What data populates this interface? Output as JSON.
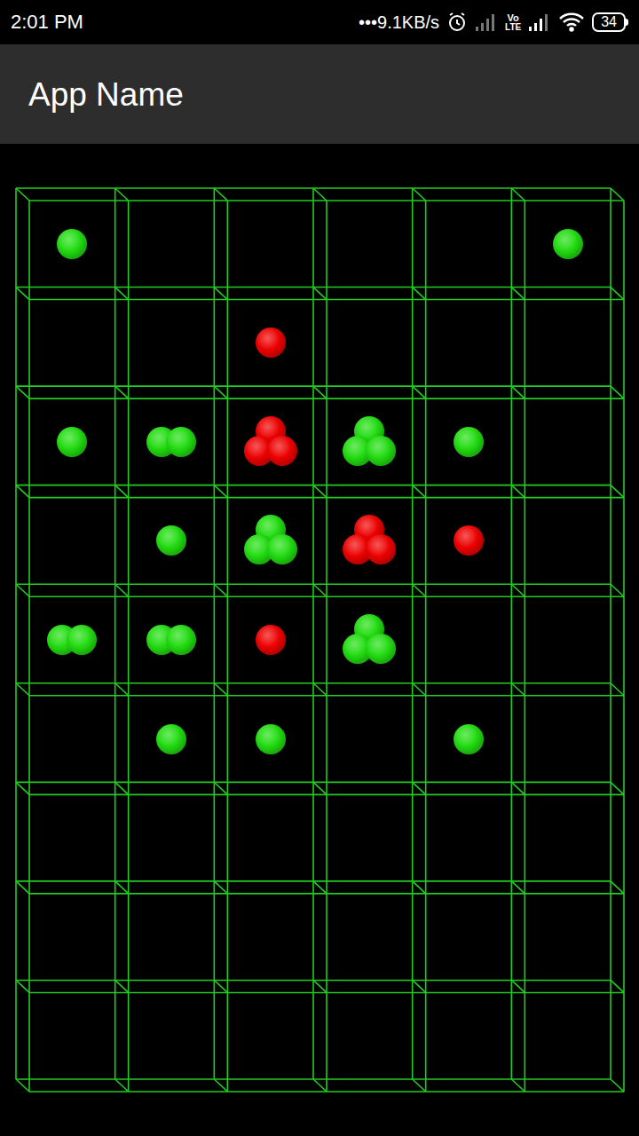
{
  "status_bar": {
    "time": "2:01 PM",
    "speed": "•••9.1KB/s",
    "volte_top": "Vo",
    "volte_bottom": "LTE",
    "battery": "34"
  },
  "app_bar": {
    "title": "App Name"
  },
  "board": {
    "rows": [
      [
        {
          "count": 1,
          "color": "#22dd11"
        },
        {
          "count": 0
        },
        {
          "count": 0
        },
        {
          "count": 0
        },
        {
          "count": 0
        },
        {
          "count": 1,
          "color": "#22dd11"
        }
      ],
      [
        {
          "count": 0
        },
        {
          "count": 0
        },
        {
          "count": 1,
          "color": "#ee0000"
        },
        {
          "count": 0
        },
        {
          "count": 0
        },
        {
          "count": 0
        }
      ],
      [
        {
          "count": 1,
          "color": "#22dd11"
        },
        {
          "count": 2,
          "color": "#22dd11"
        },
        {
          "count": 3,
          "color": "#ee0000"
        },
        {
          "count": 3,
          "color": "#22dd11"
        },
        {
          "count": 1,
          "color": "#22dd11"
        },
        {
          "count": 0
        }
      ],
      [
        {
          "count": 0
        },
        {
          "count": 1,
          "color": "#22dd11"
        },
        {
          "count": 3,
          "color": "#22dd11"
        },
        {
          "count": 3,
          "color": "#ee0000"
        },
        {
          "count": 1,
          "color": "#ee0000"
        },
        {
          "count": 0
        }
      ],
      [
        {
          "count": 2,
          "color": "#22dd11"
        },
        {
          "count": 2,
          "color": "#22dd11"
        },
        {
          "count": 1,
          "color": "#ee0000"
        },
        {
          "count": 3,
          "color": "#22dd11"
        },
        {
          "count": 0
        },
        {
          "count": 0
        }
      ],
      [
        {
          "count": 0
        },
        {
          "count": 1,
          "color": "#22dd11"
        },
        {
          "count": 1,
          "color": "#22dd11"
        },
        {
          "count": 0
        },
        {
          "count": 1,
          "color": "#22dd11"
        },
        {
          "count": 0
        }
      ],
      [
        {
          "count": 0
        },
        {
          "count": 0
        },
        {
          "count": 0
        },
        {
          "count": 0
        },
        {
          "count": 0
        },
        {
          "count": 0
        }
      ],
      [
        {
          "count": 0
        },
        {
          "count": 0
        },
        {
          "count": 0
        },
        {
          "count": 0
        },
        {
          "count": 0
        },
        {
          "count": 0
        }
      ],
      [
        {
          "count": 0
        },
        {
          "count": 0
        },
        {
          "count": 0
        },
        {
          "count": 0
        },
        {
          "count": 0
        },
        {
          "count": 0
        }
      ]
    ]
  }
}
